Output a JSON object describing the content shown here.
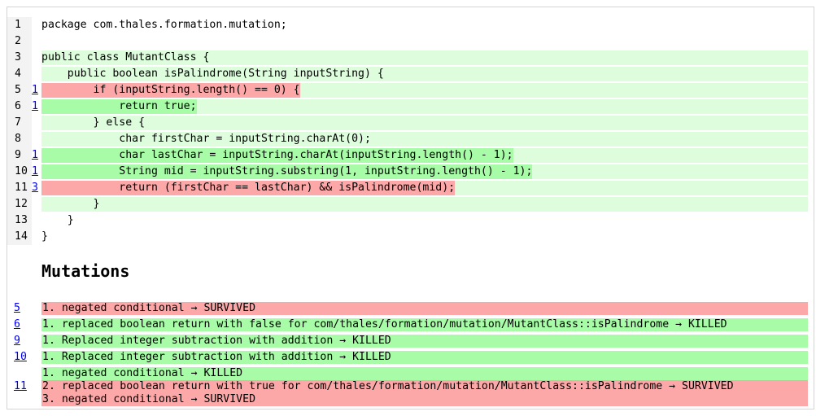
{
  "source": {
    "lines": [
      {
        "num": "1",
        "count": "",
        "code": "package com.thales.formation.mutation;",
        "status": "none"
      },
      {
        "num": "2",
        "count": "",
        "code": "",
        "status": "none"
      },
      {
        "num": "3",
        "count": "",
        "code": "public class MutantClass {",
        "status": "covered"
      },
      {
        "num": "4",
        "count": "",
        "code": "    public boolean isPalindrome(String inputString) {",
        "status": "covered"
      },
      {
        "num": "5",
        "count": "1",
        "code": "        if (inputString.length() == 0) {",
        "status": "survived"
      },
      {
        "num": "6",
        "count": "1",
        "code": "            return true;",
        "status": "killed"
      },
      {
        "num": "7",
        "count": "",
        "code": "        } else {",
        "status": "covered"
      },
      {
        "num": "8",
        "count": "",
        "code": "            char firstChar = inputString.charAt(0);",
        "status": "covered"
      },
      {
        "num": "9",
        "count": "1",
        "code": "            char lastChar = inputString.charAt(inputString.length() - 1);",
        "status": "killed"
      },
      {
        "num": "10",
        "count": "1",
        "code": "            String mid = inputString.substring(1, inputString.length() - 1);",
        "status": "killed"
      },
      {
        "num": "11",
        "count": "3",
        "code": "            return (firstChar == lastChar) && isPalindrome(mid);",
        "status": "survived"
      },
      {
        "num": "12",
        "count": "",
        "code": "        }",
        "status": "covered"
      },
      {
        "num": "13",
        "count": "",
        "code": "    }",
        "status": "none"
      },
      {
        "num": "14",
        "count": "",
        "code": "}",
        "status": "none"
      }
    ]
  },
  "mutations": {
    "title": "Mutations",
    "groups": [
      {
        "line": "5",
        "items": [
          {
            "text": "1. negated conditional → SURVIVED",
            "status": "survived"
          }
        ]
      },
      {
        "line": "6",
        "items": [
          {
            "text": "1. replaced boolean return with false for com/thales/formation/mutation/MutantClass::isPalindrome → KILLED",
            "status": "killed"
          }
        ]
      },
      {
        "line": "9",
        "items": [
          {
            "text": "1. Replaced integer subtraction with addition → KILLED",
            "status": "killed"
          }
        ]
      },
      {
        "line": "10",
        "items": [
          {
            "text": "1. Replaced integer subtraction with addition → KILLED",
            "status": "killed"
          }
        ]
      },
      {
        "line": "11",
        "items": [
          {
            "text": "1. negated conditional → KILLED",
            "status": "killed"
          },
          {
            "text": "2. replaced boolean return with true for com/thales/formation/mutation/MutantClass::isPalindrome → SURVIVED",
            "status": "survived"
          },
          {
            "text": "3. negated conditional → SURVIVED",
            "status": "survived"
          }
        ]
      }
    ]
  },
  "colors": {
    "covered": "#ddfddd",
    "killed": "#a8fca8",
    "survived": "#fca8a8"
  }
}
